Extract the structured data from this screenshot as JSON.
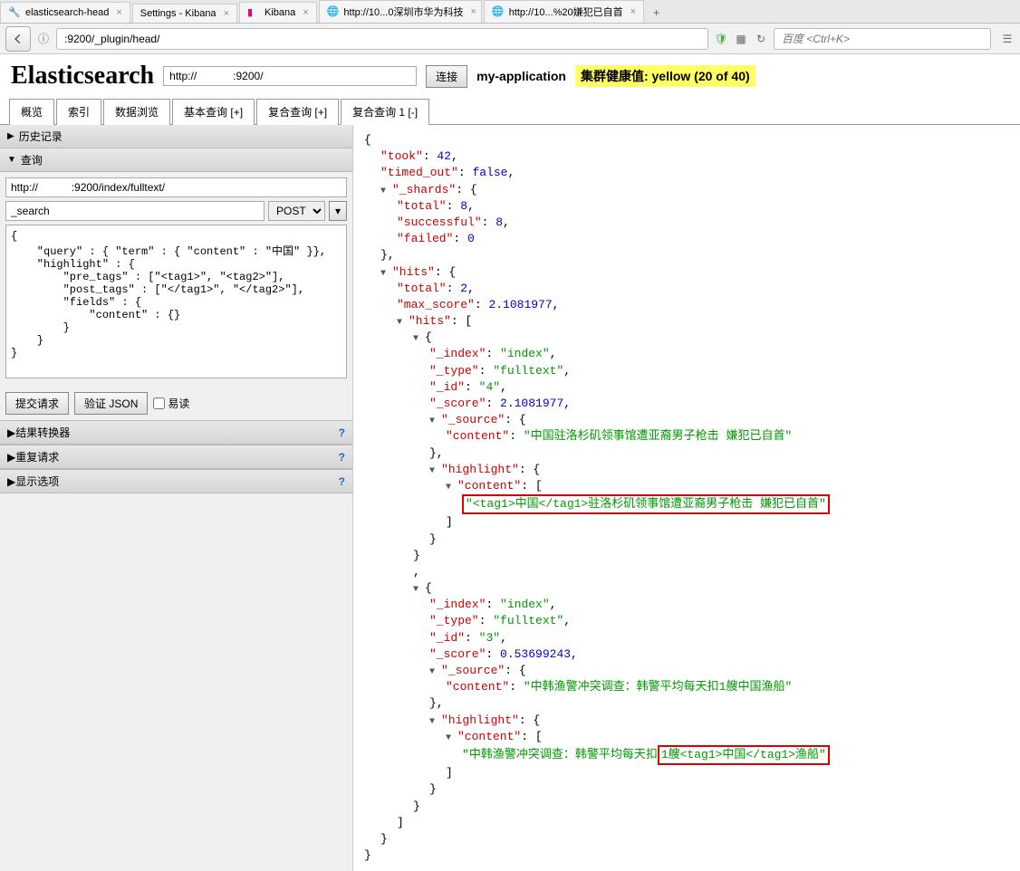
{
  "browser": {
    "tabs": [
      {
        "label": "elasticsearch-head"
      },
      {
        "label": "Settings - Kibana"
      },
      {
        "label": "Kibana"
      },
      {
        "label": "http://10...0深圳市华为科技"
      },
      {
        "label": "http://10...%20嫌犯已自首"
      }
    ],
    "url": ":9200/_plugin/head/",
    "search_placeholder": "百度 <Ctrl+K>"
  },
  "header": {
    "title": "Elasticsearch",
    "conn_url": "http://            :9200/",
    "connect_btn": "连接",
    "cluster": "my-application",
    "health": "集群健康值: yellow (20 of 40)"
  },
  "tabs": {
    "overview": "概览",
    "index": "索引",
    "browse": "数据浏览",
    "basic": "基本查询 [+]",
    "compound": "复合查询 [+]",
    "compound1": "复合查询 1 [-]"
  },
  "sidebar": {
    "history": "历史记录",
    "query": "查询",
    "server_url": "http://           :9200/index/fulltext/",
    "path": "_search",
    "method": "POST",
    "request_body": "{\n    \"query\" : { \"term\" : { \"content\" : \"中国\" }},\n    \"highlight\" : {\n        \"pre_tags\" : [\"<tag1>\", \"<tag2>\"],\n        \"post_tags\" : [\"</tag1>\", \"</tag2>\"],\n        \"fields\" : {\n            \"content\" : {}\n        }\n    }\n}",
    "submit": "提交请求",
    "validate": "验证 JSON",
    "pretty": "易读",
    "transformer": "结果转换器",
    "repeat": "重复请求",
    "display": "显示选项"
  },
  "json_response": {
    "took": 42,
    "timed_out": false,
    "_shards": {
      "total": 8,
      "successful": 8,
      "failed": 0
    },
    "hits": {
      "total": 2,
      "max_score": 2.1081977,
      "hit0": {
        "_index": "index",
        "_type": "fulltext",
        "_id": "4",
        "_score": 2.1081977,
        "content": "中国驻洛杉矶领事馆遭亚裔男子枪击 嫌犯已自首",
        "highlight": "<tag1>中国</tag1>驻洛杉矶领事馆遭亚裔男子枪击 嫌犯已自首"
      },
      "hit1": {
        "_index": "index",
        "_type": "fulltext",
        "_id": "3",
        "_score": 0.53699243,
        "content": "中韩渔警冲突调查：韩警平均每天扣1艘中国渔船",
        "highlight_pre": "中韩渔警冲突调查：韩警平均每天扣",
        "highlight_box": "1艘<tag1>中国</tag1>渔船"
      }
    }
  }
}
